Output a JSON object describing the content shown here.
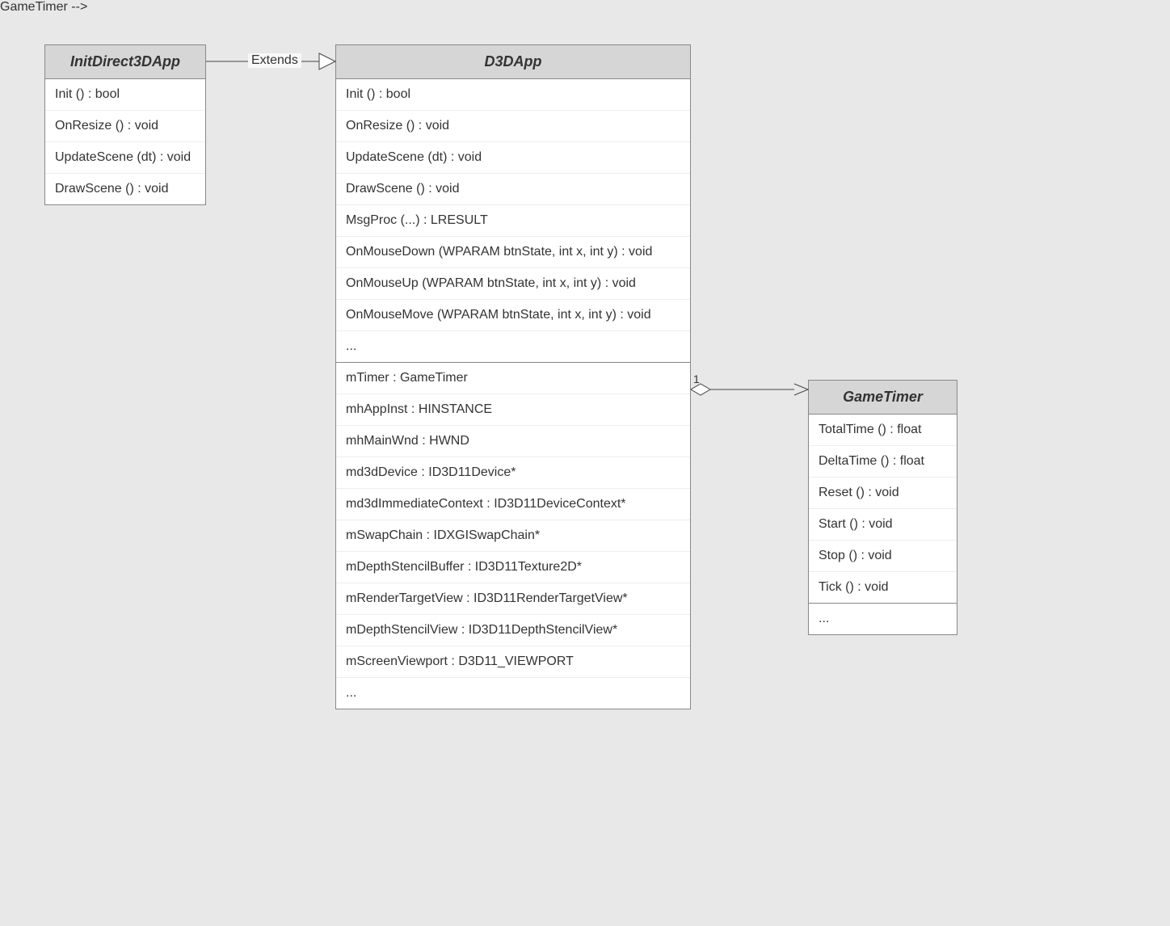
{
  "classes": {
    "initDirect3DApp": {
      "name": "InitDirect3DApp",
      "methods": [
        "Init () : bool",
        "OnResize () : void",
        "UpdateScene (dt) : void",
        "DrawScene () : void"
      ]
    },
    "d3dApp": {
      "name": "D3DApp",
      "methods": [
        "Init () : bool",
        "OnResize () : void",
        "UpdateScene (dt) : void",
        "DrawScene () : void",
        "MsgProc (...) : LRESULT",
        "OnMouseDown (WPARAM btnState, int x, int y) : void",
        "OnMouseUp (WPARAM btnState, int x, int y) : void",
        "OnMouseMove (WPARAM btnState, int x, int y) : void",
        "..."
      ],
      "attributes": [
        "mTimer : GameTimer",
        "mhAppInst : HINSTANCE",
        "mhMainWnd : HWND",
        "md3dDevice : ID3D11Device*",
        "md3dImmediateContext : ID3D11DeviceContext*",
        "mSwapChain : IDXGISwapChain*",
        "mDepthStencilBuffer : ID3D11Texture2D*",
        "mRenderTargetView : ID3D11RenderTargetView*",
        "mDepthStencilView : ID3D11DepthStencilView*",
        "mScreenViewport : D3D11_VIEWPORT",
        "..."
      ]
    },
    "gameTimer": {
      "name": "GameTimer",
      "methods": [
        "TotalTime () : float",
        "DeltaTime () : float",
        "Reset () : void",
        "Start () : void",
        "Stop () : void",
        "Tick () : void"
      ],
      "attributes": [
        "..."
      ]
    }
  },
  "relationships": {
    "extends": {
      "label": "Extends"
    },
    "aggregation": {
      "multiplicity": "1"
    }
  }
}
